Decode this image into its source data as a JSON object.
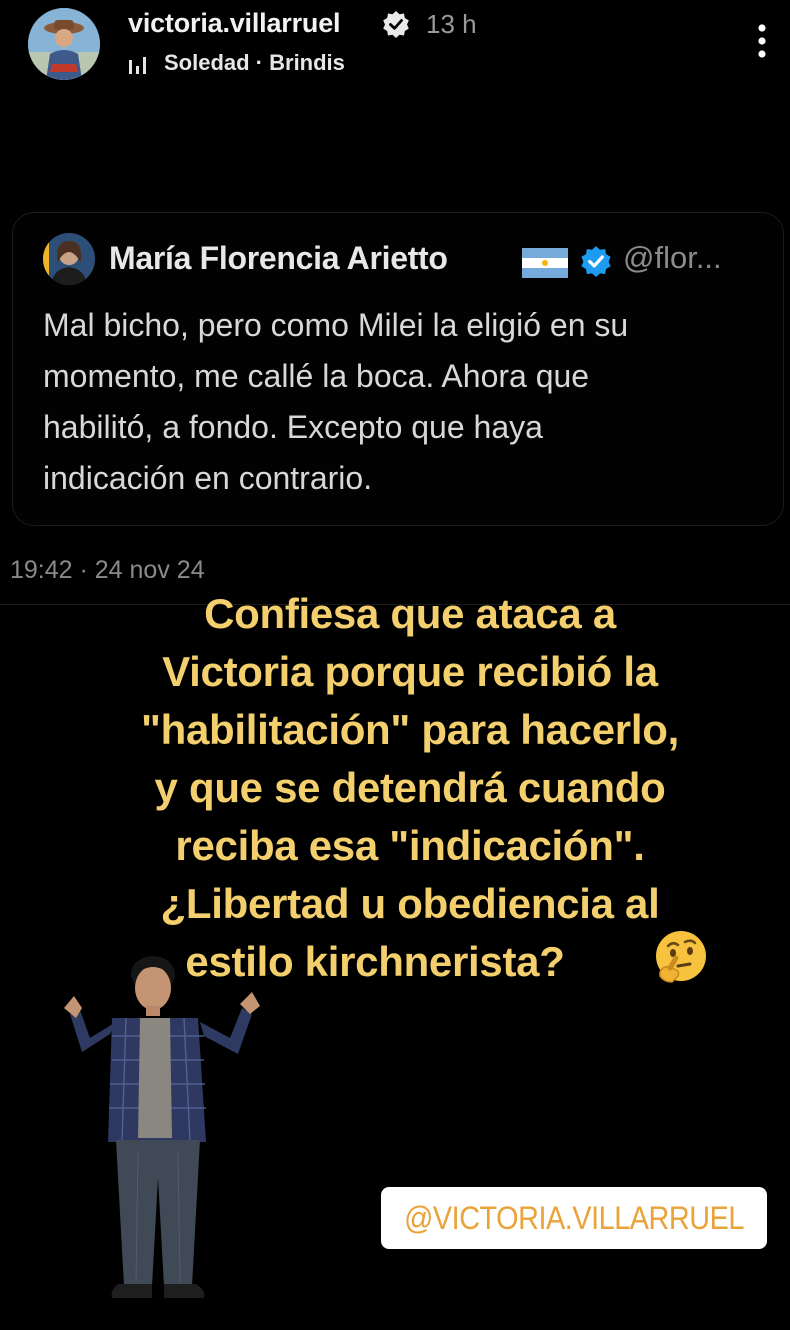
{
  "story_header": {
    "username": "victoria.villarruel",
    "time_ago": "13 h",
    "music": "Soledad · Brindis",
    "icons": [
      "avatar",
      "verified-badge-icon",
      "music-bars-icon",
      "more-options-icon"
    ]
  },
  "tweet": {
    "author_name": "María Florencia Arietto",
    "handle": "@flor...",
    "text": "Mal bicho, pero como Milei la eligió en su\nmomento, me callé la boca. Ahora que\nhabilitó, a fondo. Excepto que haya\nindicación en contrario.",
    "timestamp": "19:42 · 24 nov 24",
    "icons": [
      "tweet-avatar",
      "argentina-flag-icon",
      "verified-badge-icon"
    ]
  },
  "caption": {
    "lines": [
      "Confiesa que ataca a",
      "Victoria porque recibió la",
      "\"habilitación\" para hacerlo,",
      "y que se detendrá cuando",
      "reciba esa \"indicación\".",
      "¿Libertad u obediencia al",
      "estilo kirchnerista?"
    ],
    "emoji": "thinking-face-emoji",
    "color": "#f4cf6e"
  },
  "mention": {
    "text": "@VICTORIA.VILLARRUEL",
    "text_color": "#e9a339",
    "background": "#ffffff"
  },
  "colors": {
    "background": "#000000",
    "verified_blue": "#1d9bf0",
    "secondary_text": "#8b8b8b"
  }
}
